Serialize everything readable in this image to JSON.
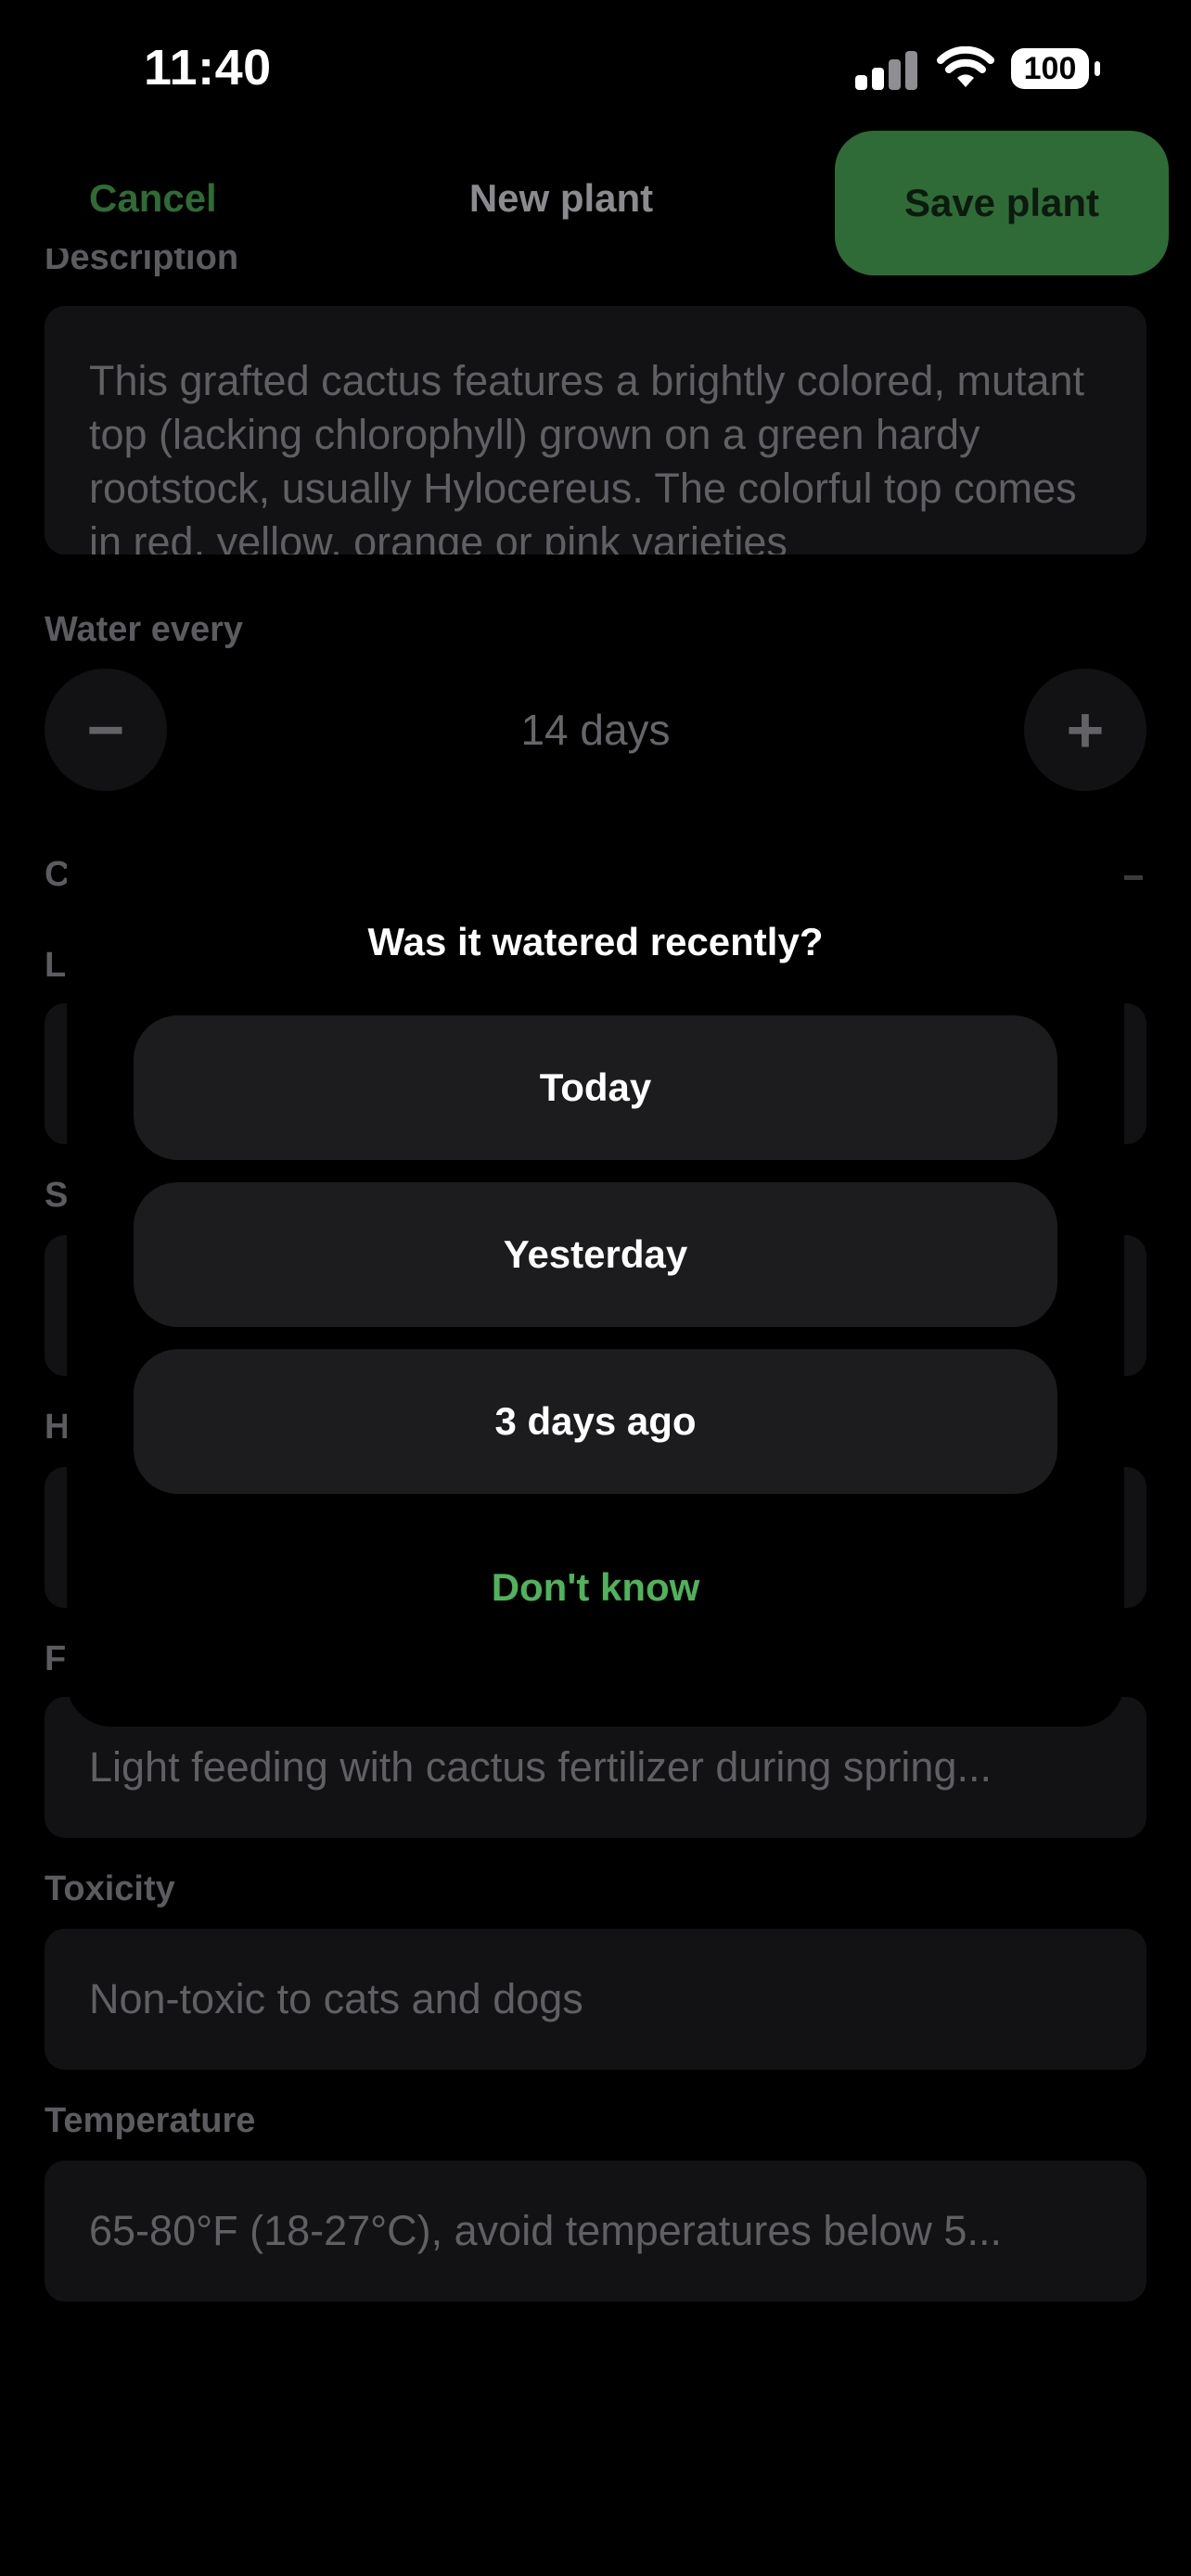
{
  "status_bar": {
    "time": "11:40",
    "battery": "100"
  },
  "nav": {
    "cancel_label": "Cancel",
    "title": "New plant",
    "save_label": "Save plant"
  },
  "form": {
    "description_label": "Description",
    "description_text": "This grafted cactus features a brightly colored, mutant top (lacking chlorophyll) grown on a green hardy rootstock, usually Hylocereus. The colorful top comes in red, yellow, orange or pink varieties",
    "water_label": "Water every",
    "water_value": "14 days",
    "minus_symbol": "−",
    "plus_symbol": "+",
    "partial_letters": {
      "section": "C",
      "row1": "L",
      "row2": "S",
      "row3": "H",
      "row4": "F"
    },
    "fertilizer_text": "Light feeding with cactus fertilizer during spring...",
    "toxicity_label": "Toxicity",
    "toxicity_text": "Non-toxic to cats and dogs",
    "temperature_label": "Temperature",
    "temperature_text": "65-80°F (18-27°C), avoid temperatures below 5..."
  },
  "modal": {
    "title": "Was it watered recently?",
    "options": [
      "Today",
      "Yesterday",
      "3 days ago"
    ],
    "dont_know_label": "Don't know"
  },
  "colors": {
    "accent": "#4fb35a",
    "save_button": "#2f6b36",
    "option_bg": "#1c1c1e"
  }
}
